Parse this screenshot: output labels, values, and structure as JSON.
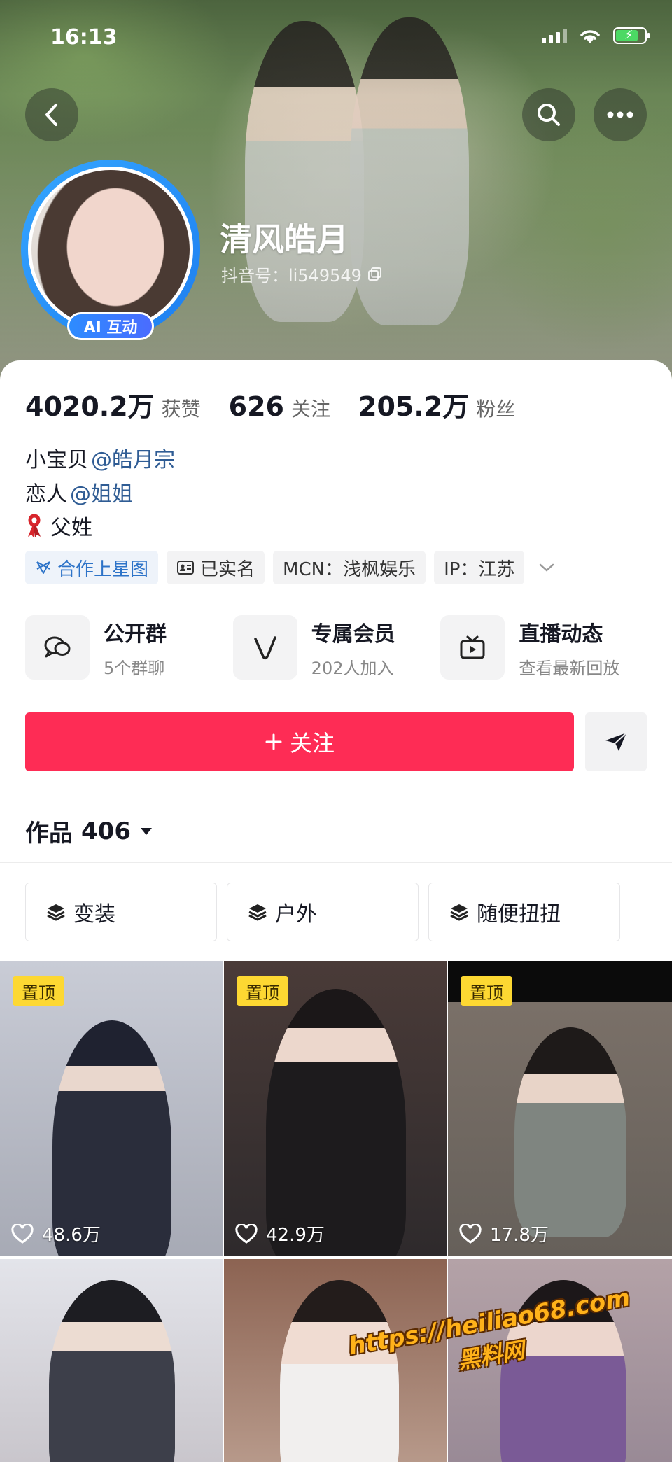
{
  "status_bar": {
    "time": "16:13"
  },
  "profile": {
    "name": "清风皓月",
    "douyin_id": "抖音号：li549549",
    "ai_badge": "AI 互动"
  },
  "stats": [
    {
      "value": "4020.2万",
      "label": "获赞"
    },
    {
      "value": "626",
      "label": "关注"
    },
    {
      "value": "205.2万",
      "label": "粉丝"
    }
  ],
  "bio": {
    "line1_text": "小宝贝",
    "line1_mention": "@皓月宗",
    "line2_text": "恋人",
    "line2_mention": "@姐姐",
    "line3_text": "父姓"
  },
  "tags": {
    "star_map": "合作上星图",
    "verified": "已实名",
    "mcn": "MCN：浅枫娱乐",
    "ip": "IP：江苏"
  },
  "services": [
    {
      "title": "公开群",
      "sub": "5个群聊",
      "icon": "chat-bubbles-icon"
    },
    {
      "title": "专属会员",
      "sub": "202人加入",
      "icon": "member-v-icon"
    },
    {
      "title": "直播动态",
      "sub": "查看最新回放",
      "icon": "tv-icon"
    }
  ],
  "follow_label": "关注",
  "works": {
    "label": "作品",
    "count": "406"
  },
  "collections": [
    "变装",
    "户外",
    "随便扭扭"
  ],
  "videos": [
    {
      "pinned": "置顶",
      "likes": "48.6万"
    },
    {
      "pinned": "置顶",
      "likes": "42.9万"
    },
    {
      "pinned": "置顶",
      "likes": "17.8万"
    },
    {
      "pinned": "",
      "likes": ""
    },
    {
      "pinned": "",
      "likes": ""
    },
    {
      "pinned": "",
      "likes": ""
    }
  ],
  "watermark": {
    "line1": "https://heiliao68.com",
    "line2": "黑料网"
  },
  "colors": {
    "follow": "#fe2c55",
    "mention": "#2f5c94",
    "pin": "#fdd832",
    "ai_badge": "#2d8cff"
  }
}
